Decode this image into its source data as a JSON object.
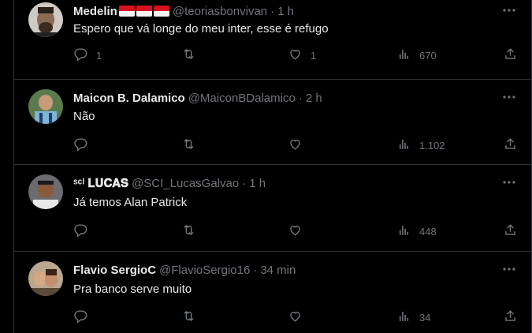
{
  "tweets": [
    {
      "name": "Medelin",
      "flags": 3,
      "handle": "@teoriasbonvivan",
      "time": "1 h",
      "text": "Espero que vá longe do meu inter, esse é refugo",
      "replies": "1",
      "retweets": "",
      "likes": "1",
      "views": "670"
    },
    {
      "name": "Maicon B. Dalamico",
      "handle": "@MaiconBDalamico",
      "time": "2 h",
      "text": "Não",
      "replies": "",
      "retweets": "",
      "likes": "",
      "views": "1.102"
    },
    {
      "name": "ˢᶜᴵ 𝐋𝐔𝐂𝐀𝐒",
      "handle": "@SCI_LucasGalvao",
      "time": "1 h",
      "text": "Já temos Alan Patrick",
      "replies": "",
      "retweets": "",
      "likes": "",
      "views": "448"
    },
    {
      "name": "Flavio SergioC",
      "handle": "@FlavioSergio16",
      "time": "34 min",
      "text": "Pra banco serve muito",
      "replies": "",
      "retweets": "",
      "likes": "",
      "views": "34"
    }
  ],
  "separator": "·",
  "colors": {
    "background": "#000000",
    "text": "#e7e9ea",
    "muted": "#71767b",
    "border": "#2f3336"
  },
  "icons": [
    "more-icon",
    "reply-icon",
    "retweet-icon",
    "like-icon",
    "views-icon",
    "share-icon"
  ]
}
